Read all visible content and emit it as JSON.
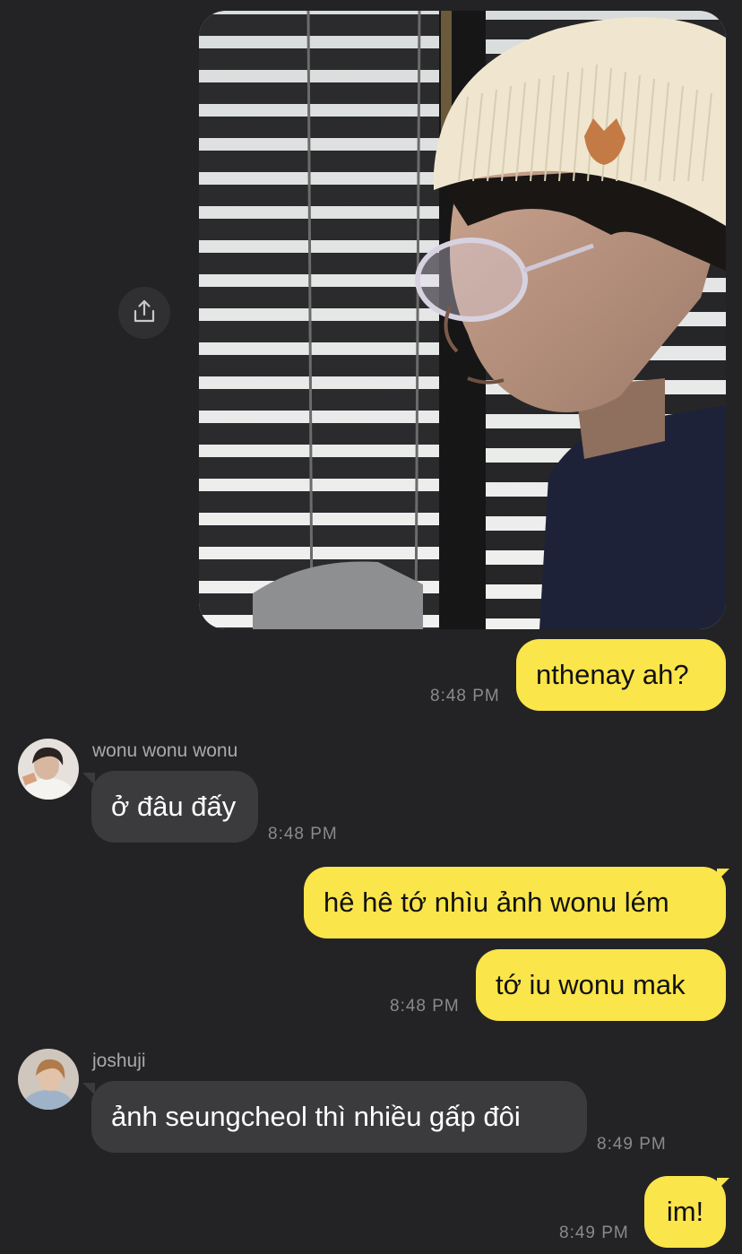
{
  "conversation": {
    "photo": {
      "description": "image attachment"
    },
    "messages": [
      {
        "type": "outgoing",
        "text": "nthenay ah?",
        "time": "8:48 PM"
      },
      {
        "type": "incoming",
        "sender": "wonu wonu wonu",
        "text": "ở đâu đấy",
        "time": "8:48 PM"
      },
      {
        "type": "outgoing",
        "text": "hê hê tớ nhìu ảnh wonu lém"
      },
      {
        "type": "outgoing",
        "text": "tớ iu wonu mak",
        "time": "8:48 PM"
      },
      {
        "type": "incoming",
        "sender": "joshuji",
        "text": "ảnh seungcheol thì nhiều gấp đôi",
        "time": "8:49 PM"
      },
      {
        "type": "outgoing",
        "text": "im!",
        "time": "8:49 PM"
      }
    ]
  },
  "colors": {
    "background": "#232325",
    "outgoing_bubble": "#fae54a",
    "incoming_bubble": "#3b3b3d",
    "timestamp": "#8a8a8d"
  },
  "icons": {
    "share": "share-icon"
  }
}
